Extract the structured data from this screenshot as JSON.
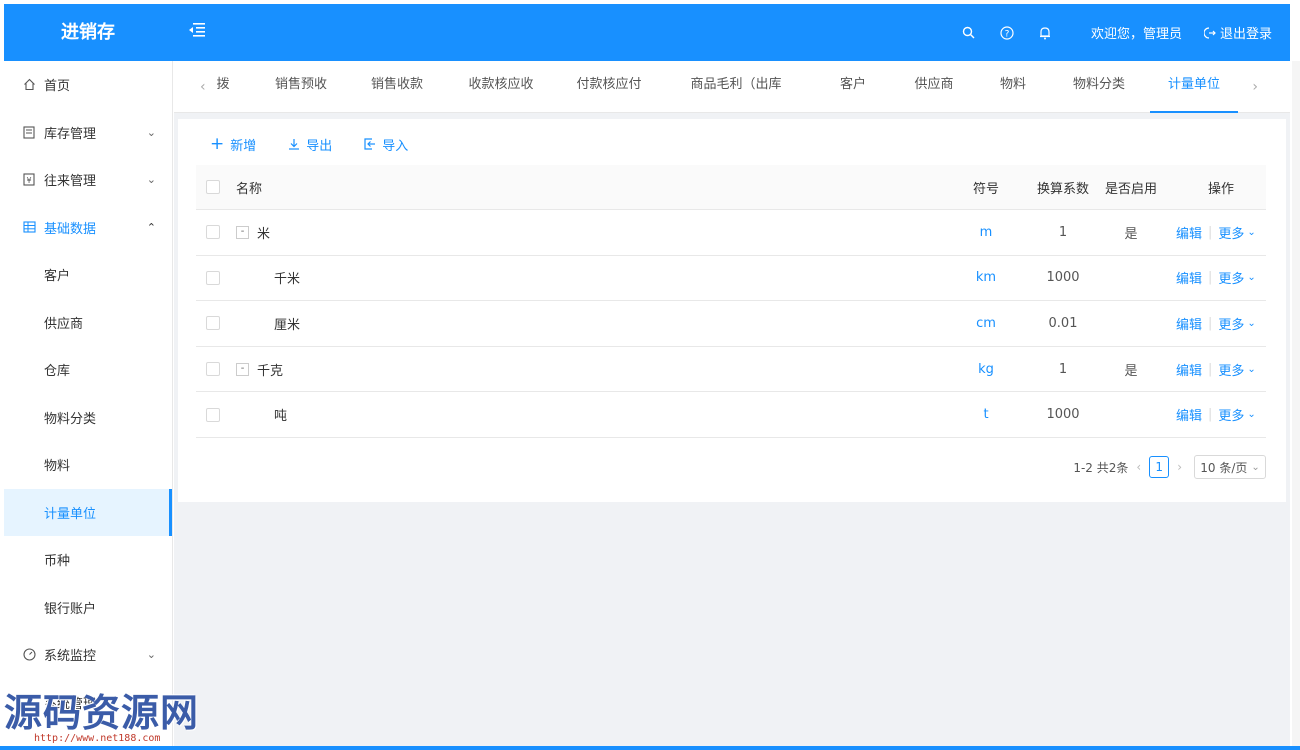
{
  "header": {
    "logo": "进销存",
    "welcome": "欢迎您，管理员",
    "logout": "退出登录",
    "icons": [
      "search-icon",
      "help-icon",
      "bell-icon"
    ],
    "accent_color": "#1890ff"
  },
  "sidebar": {
    "items": [
      {
        "label": "首页",
        "icon": "home-icon"
      },
      {
        "label": "库存管理",
        "icon": "inventory-icon"
      },
      {
        "label": "往来管理",
        "icon": "contacts-icon"
      },
      {
        "label": "基础数据",
        "icon": "grid-icon"
      },
      {
        "label": "客户"
      },
      {
        "label": "供应商"
      },
      {
        "label": "仓库"
      },
      {
        "label": "物料分类"
      },
      {
        "label": "物料"
      },
      {
        "label": "计量单位"
      },
      {
        "label": "币种"
      },
      {
        "label": "银行账户"
      },
      {
        "label": "系统监控",
        "icon": "monitor-icon"
      },
      {
        "label": "系统管理"
      }
    ]
  },
  "tabs": [
    "拨",
    "销售预收",
    "销售收款",
    "收款核应收",
    "付款核应付",
    "商品毛利（出库单）",
    "客户",
    "供应商",
    "物料",
    "物料分类",
    "计量单位"
  ],
  "toolbar": {
    "add": "新增",
    "export": "导出",
    "import": "导入"
  },
  "table": {
    "columns": {
      "name": "名称",
      "symbol": "符号",
      "factor": "换算系数",
      "enabled": "是否启用",
      "ops": "操作"
    },
    "rows": [
      {
        "name": "米",
        "symbol": "m",
        "factor": "1",
        "enabled": "是",
        "edit": "编辑",
        "more": "更多"
      },
      {
        "name": "千米",
        "symbol": "km",
        "factor": "1000",
        "enabled": "",
        "edit": "编辑",
        "more": "更多"
      },
      {
        "name": "厘米",
        "symbol": "cm",
        "factor": "0.01",
        "enabled": "",
        "edit": "编辑",
        "more": "更多"
      },
      {
        "name": "千克",
        "symbol": "kg",
        "factor": "1",
        "enabled": "是",
        "edit": "编辑",
        "more": "更多"
      },
      {
        "name": "吨",
        "symbol": "t",
        "factor": "1000",
        "enabled": "",
        "edit": "编辑",
        "more": "更多"
      }
    ],
    "expander": "-"
  },
  "pagination": {
    "total": "1-2 共2条",
    "current": "1",
    "page_size": "10 条/页"
  },
  "watermark": {
    "text": "源码资源网",
    "url": "http://www.net188.com"
  }
}
